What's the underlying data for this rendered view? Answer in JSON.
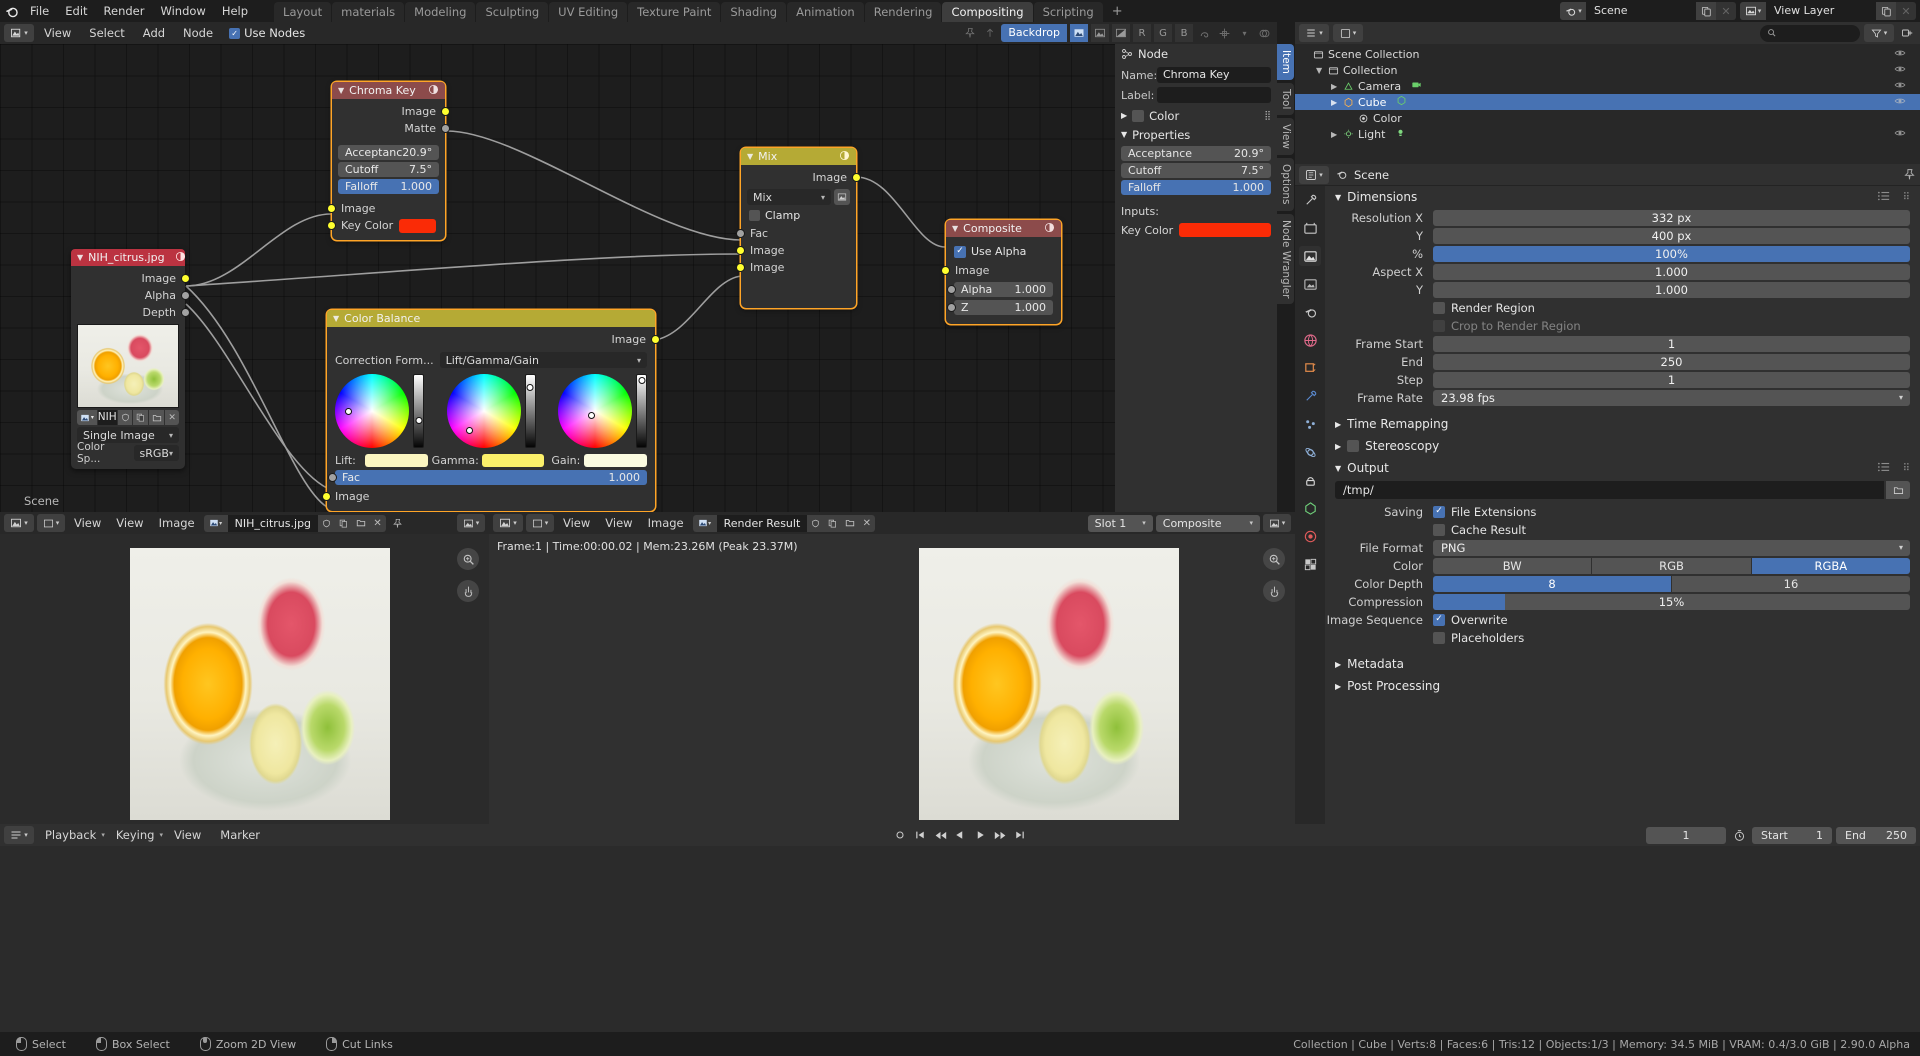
{
  "app": {
    "topbar_menus": [
      "File",
      "Edit",
      "Render",
      "Window",
      "Help"
    ],
    "workspaces": [
      {
        "label": "Layout",
        "active": false
      },
      {
        "label": "materials",
        "active": false
      },
      {
        "label": "Modeling",
        "active": false
      },
      {
        "label": "Sculpting",
        "active": false
      },
      {
        "label": "UV Editing",
        "active": false
      },
      {
        "label": "Texture Paint",
        "active": false
      },
      {
        "label": "Shading",
        "active": false
      },
      {
        "label": "Animation",
        "active": false
      },
      {
        "label": "Rendering",
        "active": false
      },
      {
        "label": "Compositing",
        "active": true
      },
      {
        "label": "Scripting",
        "active": false
      }
    ],
    "add_workspace": "+",
    "scene_name": "Scene",
    "view_layer_name": "View Layer"
  },
  "node_editor": {
    "menus": [
      "View",
      "Select",
      "Add",
      "Node"
    ],
    "use_nodes_label": "Use Nodes",
    "use_nodes_checked": true,
    "backdrop_label": "Backdrop",
    "channel_buttons": [
      "R",
      "G",
      "B"
    ],
    "scene_label": "Scene",
    "nodes": [
      {
        "id": "chroma_key",
        "title": "Chroma Key",
        "header_color": "#8c4b4b",
        "selected": true,
        "outputs": [
          "Image",
          "Matte"
        ],
        "props": [
          {
            "label": "Acceptanc",
            "value": "20.9°",
            "highlight": false
          },
          {
            "label": "Cutoff",
            "value": "7.5°",
            "highlight": false
          },
          {
            "label": "Falloff",
            "value": "1.000",
            "highlight": true
          }
        ],
        "inputs": [
          {
            "label": "Image",
            "socket": "yellow"
          },
          {
            "label": "Key Color",
            "socket": "yellow",
            "color": "#fa2b06"
          }
        ]
      },
      {
        "id": "image_node",
        "title": "NIH_citrus.jpg",
        "header_color": "#bb3341",
        "selected": false,
        "outputs": [
          "Image",
          "Alpha",
          "Depth"
        ],
        "datablock_name": "NIH",
        "source_value": "Single Image",
        "colorspace_label": "Color Sp...",
        "colorspace_value": "sRGB"
      },
      {
        "id": "color_balance",
        "title": "Color Balance",
        "header_color": "#b5aa35",
        "selected": true,
        "outputs": [
          "Image"
        ],
        "correction_label": "Correction Form...",
        "correction_value": "Lift/Gamma/Gain",
        "wheels": [
          {
            "label": "Lift:",
            "swatch": "#fbf5c0"
          },
          {
            "label": "Gamma:",
            "swatch": "#fbf06a"
          },
          {
            "label": "Gain:",
            "swatch": "#fbfbe0"
          }
        ],
        "fac_label": "Fac",
        "fac_value": "1.000",
        "image_input": "Image"
      },
      {
        "id": "mix",
        "title": "Mix",
        "header_color": "#b5aa35",
        "selected": true,
        "outputs": [
          "Image"
        ],
        "blend_mode": "Mix",
        "clamp_label": "Clamp",
        "clamp_checked": false,
        "inputs": [
          "Fac",
          "Image",
          "Image"
        ]
      },
      {
        "id": "composite",
        "title": "Composite",
        "header_color": "#8c4b4b",
        "selected": true,
        "use_alpha_label": "Use Alpha",
        "use_alpha_checked": true,
        "inputs": [
          {
            "label": "Image",
            "value": "",
            "socket": "yellow"
          },
          {
            "label": "Alpha",
            "value": "1.000",
            "socket": "grey"
          },
          {
            "label": "Z",
            "value": "1.000",
            "socket": "grey"
          }
        ]
      }
    ]
  },
  "node_sidebar": {
    "title": "Node",
    "name_label": "Name:",
    "name_value": "Chroma Key",
    "label_label": "Label:",
    "label_value": "",
    "properties_section": "Properties",
    "color_label": "Color",
    "color_checked": false,
    "props": [
      {
        "label": "Acceptance",
        "value": "20.9°",
        "highlight": false
      },
      {
        "label": "Cutoff",
        "value": "7.5°",
        "highlight": false
      },
      {
        "label": "Falloff",
        "value": "1.000",
        "highlight": true
      }
    ],
    "inputs_label": "Inputs:",
    "key_color_label": "Key Color",
    "key_color_value": "#fa2b06",
    "tabs": [
      "Item",
      "Tool",
      "View",
      "Options",
      "Node Wrangler"
    ]
  },
  "outliner": {
    "search_placeholder": "",
    "rows": [
      {
        "label": "Scene Collection",
        "indent": 0,
        "icon": "collection-icon",
        "selected": false,
        "disclosure": ""
      },
      {
        "label": "Collection",
        "indent": 1,
        "icon": "collection-icon",
        "selected": false,
        "disclosure": "▼"
      },
      {
        "label": "Camera",
        "indent": 2,
        "icon": "camera-icon",
        "selected": false,
        "disclosure": "▶"
      },
      {
        "label": "Cube",
        "indent": 2,
        "icon": "mesh-icon",
        "selected": true,
        "disclosure": "▶"
      },
      {
        "label": "Color",
        "indent": 3,
        "icon": "material-icon",
        "selected": false,
        "disclosure": ""
      },
      {
        "label": "Light",
        "indent": 2,
        "icon": "light-icon",
        "selected": false,
        "disclosure": "▶"
      }
    ]
  },
  "properties": {
    "scene_label": "Scene",
    "sections": [
      {
        "title": "Dimensions",
        "expanded": true,
        "rows": [
          {
            "type": "num",
            "label": "Resolution X",
            "value": "332 px",
            "highlight": false
          },
          {
            "type": "num",
            "label": "Y",
            "value": "400 px",
            "highlight": false
          },
          {
            "type": "num",
            "label": "%",
            "value": "100%",
            "highlight": true
          },
          {
            "type": "num",
            "label": "Aspect X",
            "value": "1.000",
            "highlight": false
          },
          {
            "type": "num",
            "label": "Y",
            "value": "1.000",
            "highlight": false
          },
          {
            "type": "check",
            "label": "Render Region",
            "checked": false,
            "dim": false
          },
          {
            "type": "check",
            "label": "Crop to Render Region",
            "checked": false,
            "dim": true
          },
          {
            "type": "num",
            "label": "Frame Start",
            "value": "1",
            "highlight": false
          },
          {
            "type": "num",
            "label": "End",
            "value": "250",
            "highlight": false
          },
          {
            "type": "num",
            "label": "Step",
            "value": "1",
            "highlight": false
          },
          {
            "type": "dropdown",
            "label": "Frame Rate",
            "value": "23.98 fps"
          }
        ]
      },
      {
        "title": "Time Remapping",
        "expanded": false,
        "rows": []
      },
      {
        "title": "Stereoscopy",
        "expanded": false,
        "rows": [],
        "checkbox": true
      },
      {
        "title": "Output",
        "expanded": true,
        "path_value": "/tmp/",
        "rows": [
          {
            "type": "check",
            "label": "File Extensions",
            "checked": true,
            "rowlabel": "Saving"
          },
          {
            "type": "check",
            "label": "Cache Result",
            "checked": false,
            "rowlabel": ""
          },
          {
            "type": "dropdown",
            "label": "File Format",
            "value": "PNG"
          },
          {
            "type": "seg",
            "label": "Color",
            "options": [
              "BW",
              "RGB",
              "RGBA"
            ],
            "selected": "RGBA"
          },
          {
            "type": "seg",
            "label": "Color Depth",
            "options": [
              "8",
              "16"
            ],
            "selected": "8"
          },
          {
            "type": "num",
            "label": "Compression",
            "value": "15%",
            "highlight": true,
            "slider": 15
          },
          {
            "type": "check",
            "label": "Overwrite",
            "checked": true,
            "rowlabel": "Image Sequence"
          },
          {
            "type": "check",
            "label": "Placeholders",
            "checked": false,
            "rowlabel": ""
          }
        ]
      },
      {
        "title": "Metadata",
        "expanded": false,
        "rows": []
      },
      {
        "title": "Post Processing",
        "expanded": false,
        "rows": []
      }
    ]
  },
  "image_editor": {
    "menus": [
      "View",
      "Image"
    ],
    "view_label": "View",
    "image_name": "NIH_citrus.jpg"
  },
  "viewer": {
    "menus": [
      "View",
      "Image"
    ],
    "view_label": "View",
    "render_result": "Render Result",
    "slot_label": "Slot 1",
    "pass_label": "Composite",
    "stats": "Frame:1 | Time:00:00.02 | Mem:23.26M (Peak 23.37M)"
  },
  "timeline": {
    "menus": [
      "Playback",
      "Keying",
      "View",
      "Marker"
    ],
    "current_frame": "1",
    "start_label": "Start",
    "start_value": "1",
    "end_label": "End",
    "end_value": "250"
  },
  "status_bar": {
    "hints": [
      {
        "icon": "mouse-left",
        "label": "Select"
      },
      {
        "icon": "mouse-left-drag",
        "label": "Box Select"
      },
      {
        "icon": "mouse-middle",
        "label": "Zoom 2D View"
      },
      {
        "icon": "mouse-right",
        "label": "Cut Links"
      }
    ],
    "scene_stats": "Collection | Cube | Verts:8 | Faces:6 | Tris:12 | Objects:1/3 | Memory: 34.5 MiB | VRAM: 0.4/3.0 GiB | 2.90.0 Alpha"
  },
  "colors": {
    "accent_blue": "#4772b3",
    "key_color": "#fa2b06",
    "node_red_header": "#8c4b4b",
    "node_image_header": "#bb3341",
    "node_yellow_header": "#b5aa35",
    "selected_outline": "#ffa527"
  }
}
